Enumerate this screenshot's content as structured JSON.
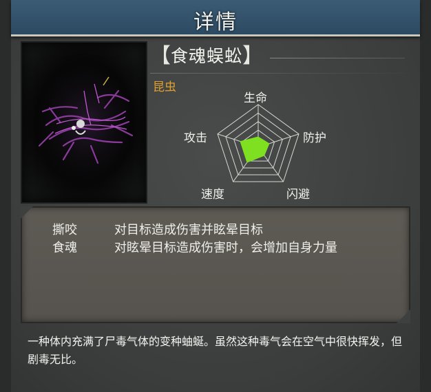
{
  "header": {
    "title": "详情"
  },
  "creature": {
    "name": "食魂蜈蚣",
    "bracket_left": "【",
    "bracket_right": "】",
    "category": "昆虫",
    "portrait_icon": "centipede-portrait"
  },
  "stats": {
    "labels": {
      "hp": "生命",
      "defense": "防护",
      "dodge": "闪避",
      "speed": "速度",
      "attack": "攻击"
    },
    "values": {
      "hp": 0.25,
      "defense": 0.28,
      "dodge": 0.25,
      "speed": 0.45,
      "attack": 0.45
    },
    "levels": 5,
    "fill_color": "#7ee021"
  },
  "skills": [
    {
      "name": "撕咬",
      "effect": "对目标造成伤害并眩晕目标"
    },
    {
      "name": "食魂",
      "effect": "对眩晕目标造成伤害时，会增加自身力量"
    }
  ],
  "description": "一种体内充满了尸毒气体的变种蚰蜒。虽然这种毒气会在空气中很快挥发，但剧毒无比。",
  "colors": {
    "header_bg": "#2f4f68",
    "category_text": "#e2a02f",
    "panel_bg": "#5b5852"
  }
}
